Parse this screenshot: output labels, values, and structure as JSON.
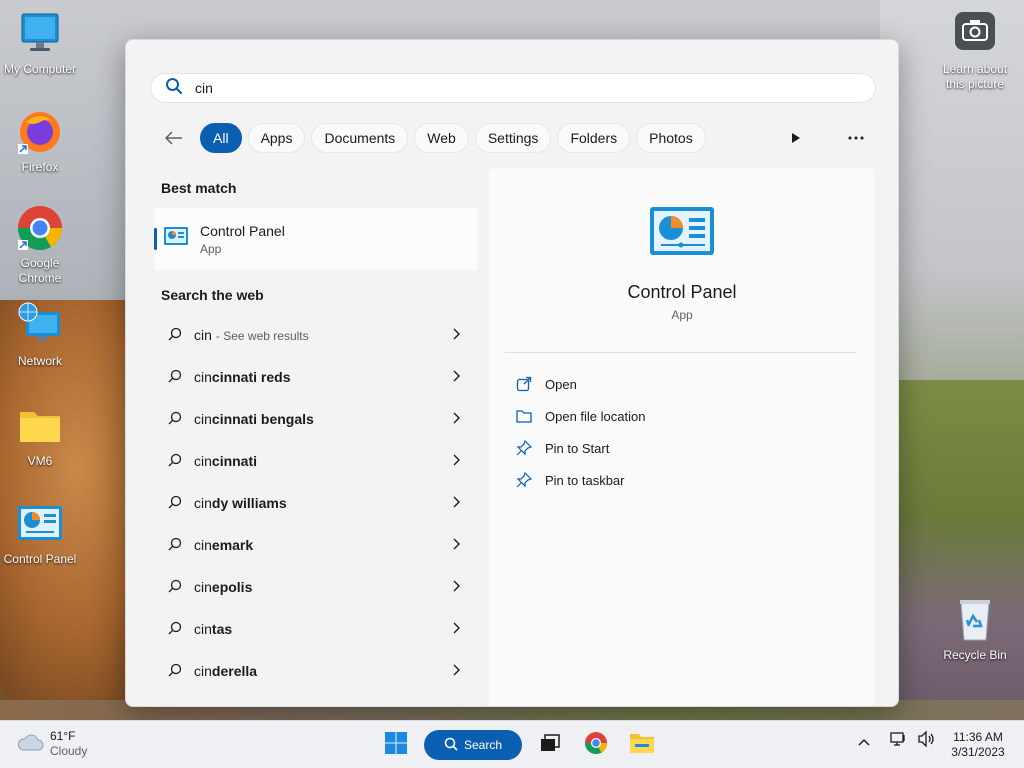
{
  "desktop": {
    "icons": [
      {
        "label": "My Computer"
      },
      {
        "label": "Firefox"
      },
      {
        "label": "Google Chrome"
      },
      {
        "label": "Network"
      },
      {
        "label": "VM6"
      },
      {
        "label": "Control Panel"
      },
      {
        "label": "Learn about this picture"
      },
      {
        "label": "Recycle Bin"
      }
    ]
  },
  "search": {
    "query": "cin",
    "filters": [
      "All",
      "Apps",
      "Documents",
      "Web",
      "Settings",
      "Folders",
      "Photos"
    ],
    "active_filter": "All"
  },
  "best_match": {
    "heading": "Best match",
    "name": "Control Panel",
    "type": "App"
  },
  "web": {
    "heading": "Search the web",
    "first": {
      "prefix": "cin",
      "hint": "- See web results"
    },
    "suggestions": [
      {
        "prefix": "cin",
        "rest": "cinnati reds"
      },
      {
        "prefix": "cin",
        "rest": "cinnati bengals"
      },
      {
        "prefix": "cin",
        "rest": "cinnati"
      },
      {
        "prefix": "cin",
        "rest": "dy williams"
      },
      {
        "prefix": "cin",
        "rest": "emark"
      },
      {
        "prefix": "cin",
        "rest": "epolis"
      },
      {
        "prefix": "cin",
        "rest": "tas"
      },
      {
        "prefix": "cin",
        "rest": "derella"
      }
    ]
  },
  "detail": {
    "title": "Control Panel",
    "type": "App",
    "actions": [
      "Open",
      "Open file location",
      "Pin to Start",
      "Pin to taskbar"
    ]
  },
  "taskbar": {
    "weather_temp": "61°F",
    "weather_desc": "Cloudy",
    "search_label": "Search",
    "time": "11:36 AM",
    "date": "3/31/2023"
  },
  "colors": {
    "accent": "#0a5fb0"
  }
}
